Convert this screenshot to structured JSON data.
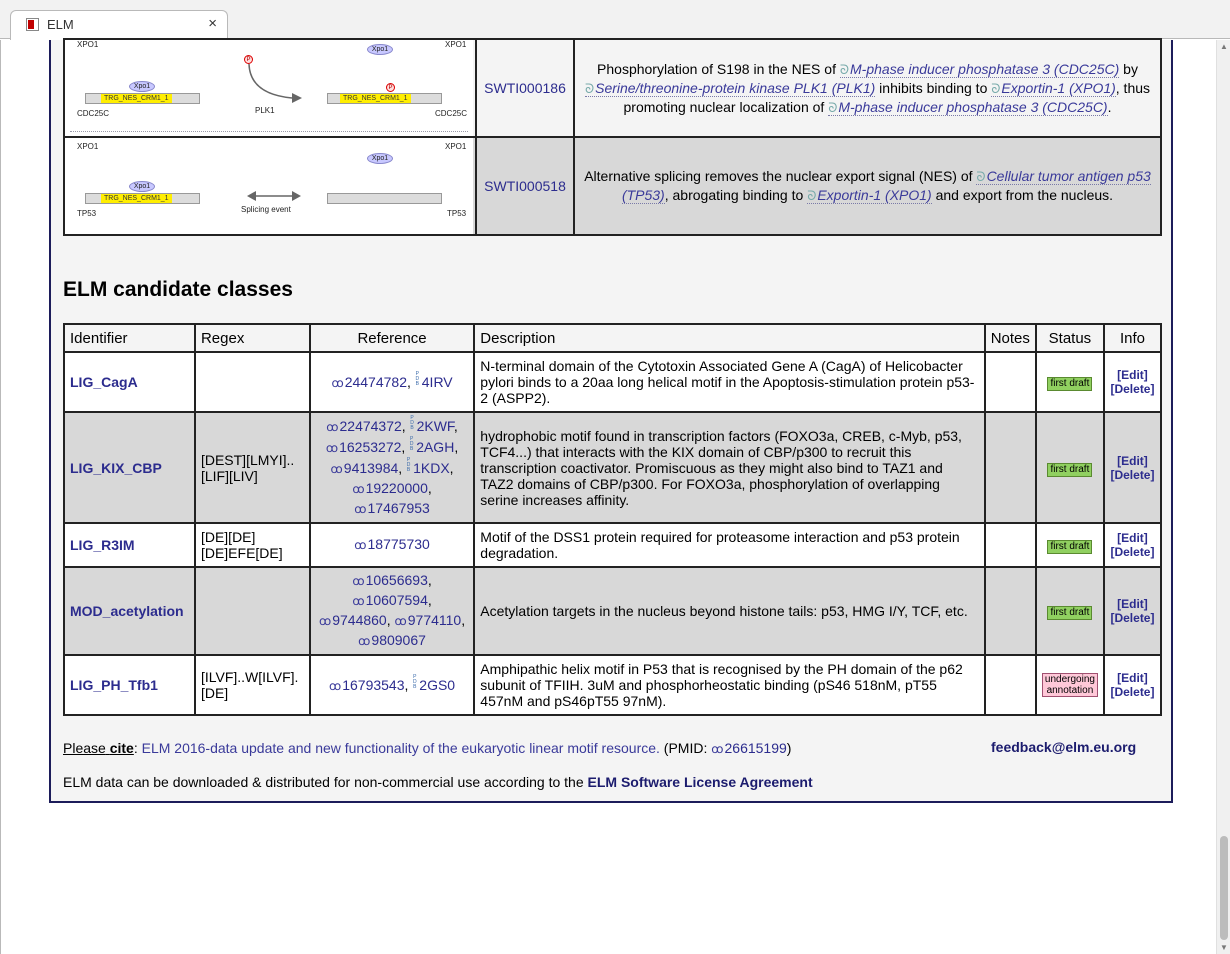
{
  "browser": {
    "tab_title": "ELM",
    "close_glyph": "×"
  },
  "switches": [
    {
      "id": "SWTI000186",
      "diagram": {
        "top_left": "XPO1",
        "top_right": "XPO1",
        "xpo_left": "Xpo1",
        "xpo_right": "Xpo1",
        "motif_left": "TRG_NES_CRM1_1",
        "motif_right": "TRG_NES_CRM1_1",
        "bottom_left": "CDC25C",
        "bottom_right": "CDC25C",
        "event": "PLK1",
        "p_marker": "P"
      },
      "desc": {
        "t1": "Phosphorylation of S198 in the NES of ",
        "l1": "M-phase inducer phosphatase 3 (CDC25C)",
        "t2": " by ",
        "l2": "Serine/threonine-protein kinase PLK1 (PLK1)",
        "t3": " inhibits binding to ",
        "l3": "Exportin-1 (XPO1)",
        "t4": ", thus promoting nuclear localization of ",
        "l4": "M-phase inducer phosphatase 3 (CDC25C)",
        "t5": "."
      }
    },
    {
      "id": "SWTI000518",
      "diagram": {
        "top_left": "XPO1",
        "top_right": "XPO1",
        "xpo_left": "Xpo1",
        "xpo_right": "Xpo1",
        "motif_left": "TRG_NES_CRM1_1",
        "bottom_left": "TP53",
        "bottom_right": "TP53",
        "event": "Splicing event"
      },
      "desc": {
        "t1": "Alternative splicing removes the nuclear export signal (NES) of ",
        "l1": "Cellular tumor antigen p53 (TP53)",
        "t2": ", abrogating binding to ",
        "l2": "Exportin-1 (XPO1)",
        "t3": " and export from the nucleus."
      }
    }
  ],
  "section_title": "ELM candidate classes",
  "candidates": {
    "headers": {
      "identifier": "Identifier",
      "regex": "Regex",
      "reference": "Reference",
      "description": "Description",
      "notes": "Notes",
      "status": "Status",
      "info": "Info"
    },
    "edit": "[Edit]",
    "delete": "[Delete]",
    "rows": [
      {
        "id": "LIG_CagA",
        "regex": "",
        "refs": {
          "p1": "24474782",
          "sep1": ", ",
          "d1": "4IRV"
        },
        "description": "N-terminal domain of the Cytotoxin Associated Gene A (CagA) of Helicobacter pylori binds to a 20aa long helical motif in the Apoptosis-stimulation protein p53-2 (ASPP2).",
        "notes": "",
        "status": "first draft"
      },
      {
        "id": "LIG_KIX_CBP",
        "regex": "[DEST][LMYI]..[LIF][LIV]",
        "refs": {
          "p1": "22474372",
          "d1": "2KWF",
          "p2": "16253272",
          "d2": "2AGH",
          "p3": "9413984",
          "d3": "1KDX",
          "p4": "19220000",
          "p5": "17467953",
          "sep": ", "
        },
        "description": "hydrophobic motif found in transcription factors (FOXO3a, CREB, c-Myb, p53, TCF4...) that interacts with the KIX domain of CBP/p300 to recruit this transcription coactivator. Promiscuous as they might also bind to TAZ1 and TAZ2 domains of CBP/p300. For FOXO3a, phosphorylation of overlapping serine increases affinity.",
        "notes": "",
        "status": "first draft"
      },
      {
        "id": "LIG_R3IM",
        "regex": "[DE][DE][DE]EFE[DE]",
        "refs": {
          "p1": "18775730"
        },
        "description": "Motif of the DSS1 protein required for proteasome interaction and p53 protein degradation.",
        "notes": "",
        "status": "first draft"
      },
      {
        "id": "MOD_acetylation",
        "regex": "",
        "refs": {
          "p1": "10656693",
          "p2": "10607594",
          "p3": "9744860",
          "p4": "9774110",
          "p5": "9809067",
          "sep": ", "
        },
        "description": "Acetylation targets in the nucleus beyond histone tails: p53, HMG I/Y, TCF, etc.",
        "notes": "",
        "status": "first draft"
      },
      {
        "id": "LIG_PH_Tfb1",
        "regex": "[ILVF]..W[ILVF].[DE]",
        "refs": {
          "p1": "16793543",
          "sep1": ", ",
          "d1": "2GS0"
        },
        "description": "Amphipathic helix motif in P53 that is recognised by the PH domain of the p62 subunit of TFIIH. 3uM and phosphorheostatic binding (pS46 518nM, pT55 457nM and pS46pT55 97nM).",
        "notes": "",
        "status": "undergoing annotation"
      }
    ]
  },
  "footer": {
    "please": "Please",
    "cite": "cite",
    "colon": ": ",
    "cite_link": "ELM 2016-data update and new functionality of the eukaryotic linear motif resource.",
    "pmid_prefix": " (PMID: ",
    "pmid": "26615199",
    "pmid_suffix": ")",
    "email": "feedback@elm.eu.org",
    "license_text": "ELM data can be downloaded & distributed for non-commercial use according to the ",
    "license_link": "ELM Software License Agreement"
  },
  "icons": {
    "pubmed": "pubmed-icon",
    "pdb": "pdb-icon",
    "uniprot": "uniprot-swirl-icon"
  },
  "colors": {
    "link": "#2c2c8e",
    "border": "#1c1c5a",
    "row_grey": "#d8d8d8",
    "first_draft": "#90d060",
    "undergoing_annotation": "#ffc8d8",
    "motif": "#ffee00"
  }
}
